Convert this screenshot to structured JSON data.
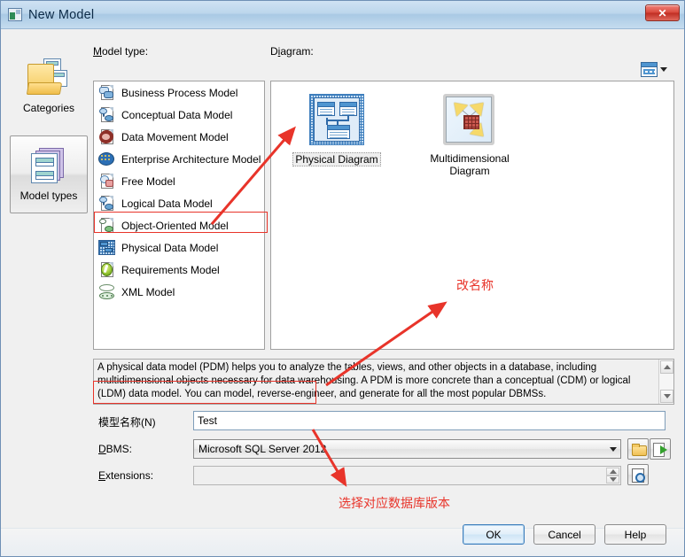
{
  "window": {
    "title": "New Model",
    "title_icon": "model-window-icon",
    "close_label": "✕"
  },
  "rail": {
    "items": [
      {
        "label": "Categories",
        "icon": "folder-pages-icon",
        "selected": false
      },
      {
        "label": "Model types",
        "icon": "stacked-pages-icon",
        "selected": true
      }
    ]
  },
  "labels": {
    "model_type": "Model type:",
    "model_type_accel": "M",
    "diagram": "Diagram:",
    "diagram_accel": "D",
    "model_name": "模型名称(N)",
    "dbms": "DBMS:",
    "dbms_accel": "D",
    "extensions": "Extensions:",
    "extensions_accel": "E"
  },
  "model_types": [
    {
      "label": "Business Process Model",
      "icon": "business-process-model-icon",
      "selected": false
    },
    {
      "label": "Conceptual Data Model",
      "icon": "conceptual-data-model-icon",
      "selected": false
    },
    {
      "label": "Data Movement Model",
      "icon": "data-movement-model-icon",
      "selected": false
    },
    {
      "label": "Enterprise Architecture Model",
      "icon": "enterprise-architecture-model-icon",
      "selected": false
    },
    {
      "label": "Free Model",
      "icon": "free-model-icon",
      "selected": false
    },
    {
      "label": "Logical Data Model",
      "icon": "logical-data-model-icon",
      "selected": false
    },
    {
      "label": "Object-Oriented Model",
      "icon": "object-oriented-model-icon",
      "selected": false
    },
    {
      "label": "Physical Data Model",
      "icon": "physical-data-model-icon",
      "selected": true
    },
    {
      "label": "Requirements Model",
      "icon": "requirements-model-icon",
      "selected": false
    },
    {
      "label": "XML Model",
      "icon": "xml-model-icon",
      "selected": false
    }
  ],
  "diagrams": [
    {
      "label": "Physical Diagram",
      "icon": "physical-diagram-icon",
      "selected": true
    },
    {
      "label": "Multidimensional Diagram",
      "icon": "multidimensional-diagram-icon",
      "selected": false
    }
  ],
  "view_mode": {
    "icon": "view-mode-icon",
    "caret": "chevron-down-icon"
  },
  "description": "A physical data model (PDM) helps you to analyze the tables, views, and other objects in a database, including multidimensional objects necessary for data warehousing. A PDM is more concrete than a conceptual (CDM) or logical (LDM) data model. You can model, reverse-engineer, and generate for all the most popular DBMSs.",
  "form": {
    "model_name_value": "Test",
    "model_name_placeholder": "",
    "dbms_value": "Microsoft SQL Server 2012",
    "extensions_value": "",
    "dbms_folder_icon": "folder-icon",
    "dbms_import_icon": "import-arrow-icon",
    "extensions_props_icon": "magnifier-properties-icon"
  },
  "footer": {
    "ok": "OK",
    "cancel": "Cancel",
    "help": "Help"
  },
  "annotations": {
    "rename": "改名称",
    "db_version": "选择对应数据库版本",
    "accent_color": "#e8342a"
  }
}
